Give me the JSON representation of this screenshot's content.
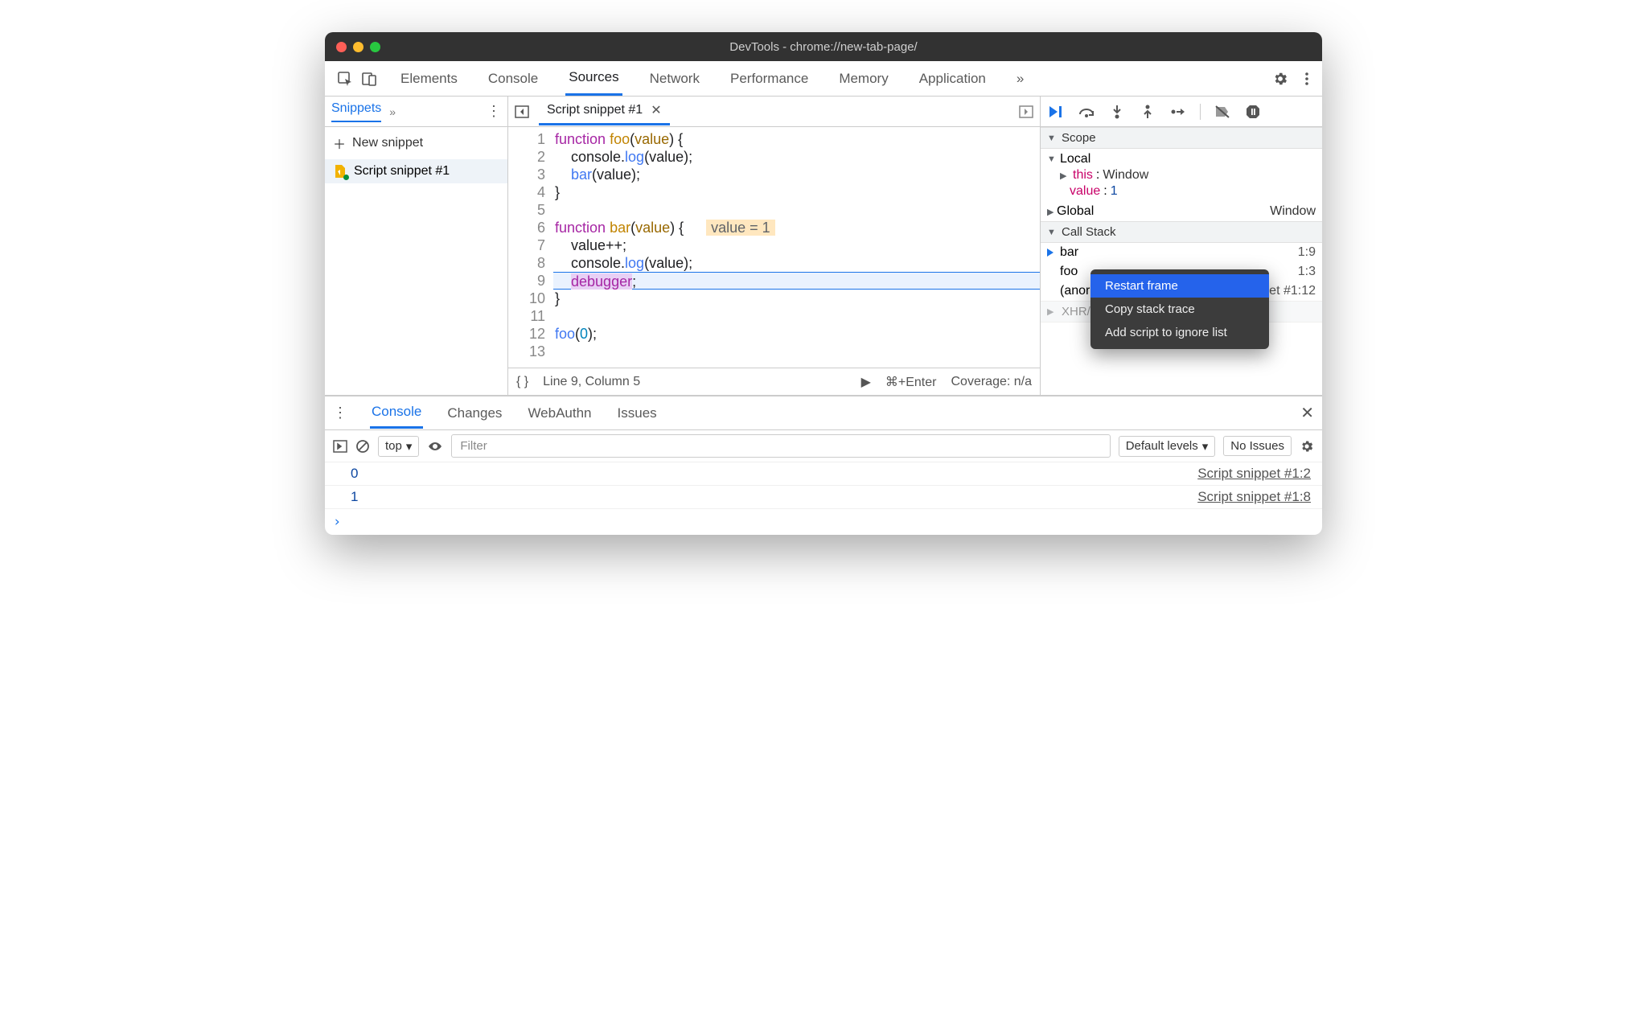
{
  "window": {
    "title": "DevTools - chrome://new-tab-page/"
  },
  "main_tabs": [
    "Elements",
    "Console",
    "Sources",
    "Network",
    "Performance",
    "Memory",
    "Application"
  ],
  "main_tabs_more": "»",
  "active_main_tab": "Sources",
  "left": {
    "tab": "Snippets",
    "more": "»",
    "new_snippet": "New snippet",
    "file": "Script snippet #1"
  },
  "editor": {
    "tab": "Script snippet #1",
    "lines": [
      "function foo(value) {",
      "    console.log(value);",
      "    bar(value);",
      "}",
      "",
      "function bar(value) {",
      "    value++;",
      "    console.log(value);",
      "    debugger;",
      "}",
      "",
      "foo(0);",
      ""
    ],
    "inline_hint": "value = 1",
    "footer": {
      "pos": "Line 9, Column 5",
      "run": "⌘+Enter",
      "coverage": "Coverage: n/a"
    }
  },
  "scope": {
    "title": "Scope",
    "local": "Local",
    "this_label": "this",
    "this_value": "Window",
    "value_label": "value",
    "value_value": "1",
    "global_label": "Global",
    "global_value": "Window"
  },
  "callstack": {
    "title": "Call Stack",
    "rows": [
      {
        "fn": "bar",
        "loc": "1:9"
      },
      {
        "fn": "foo",
        "loc": "1:3"
      },
      {
        "fn": "(anor",
        "loc": "Script snippet #1:12"
      }
    ]
  },
  "xhr_section": "XHR/fetch Breakpoints",
  "context_menu": [
    "Restart frame",
    "Copy stack trace",
    "Add script to ignore list"
  ],
  "drawer": {
    "tabs": [
      "Console",
      "Changes",
      "WebAuthn",
      "Issues"
    ],
    "active": "Console",
    "ctx": "top",
    "filter_placeholder": "Filter",
    "levels": "Default levels",
    "no_issues": "No Issues",
    "logs": [
      {
        "val": "0",
        "src": "Script snippet #1:2"
      },
      {
        "val": "1",
        "src": "Script snippet #1:8"
      }
    ]
  }
}
